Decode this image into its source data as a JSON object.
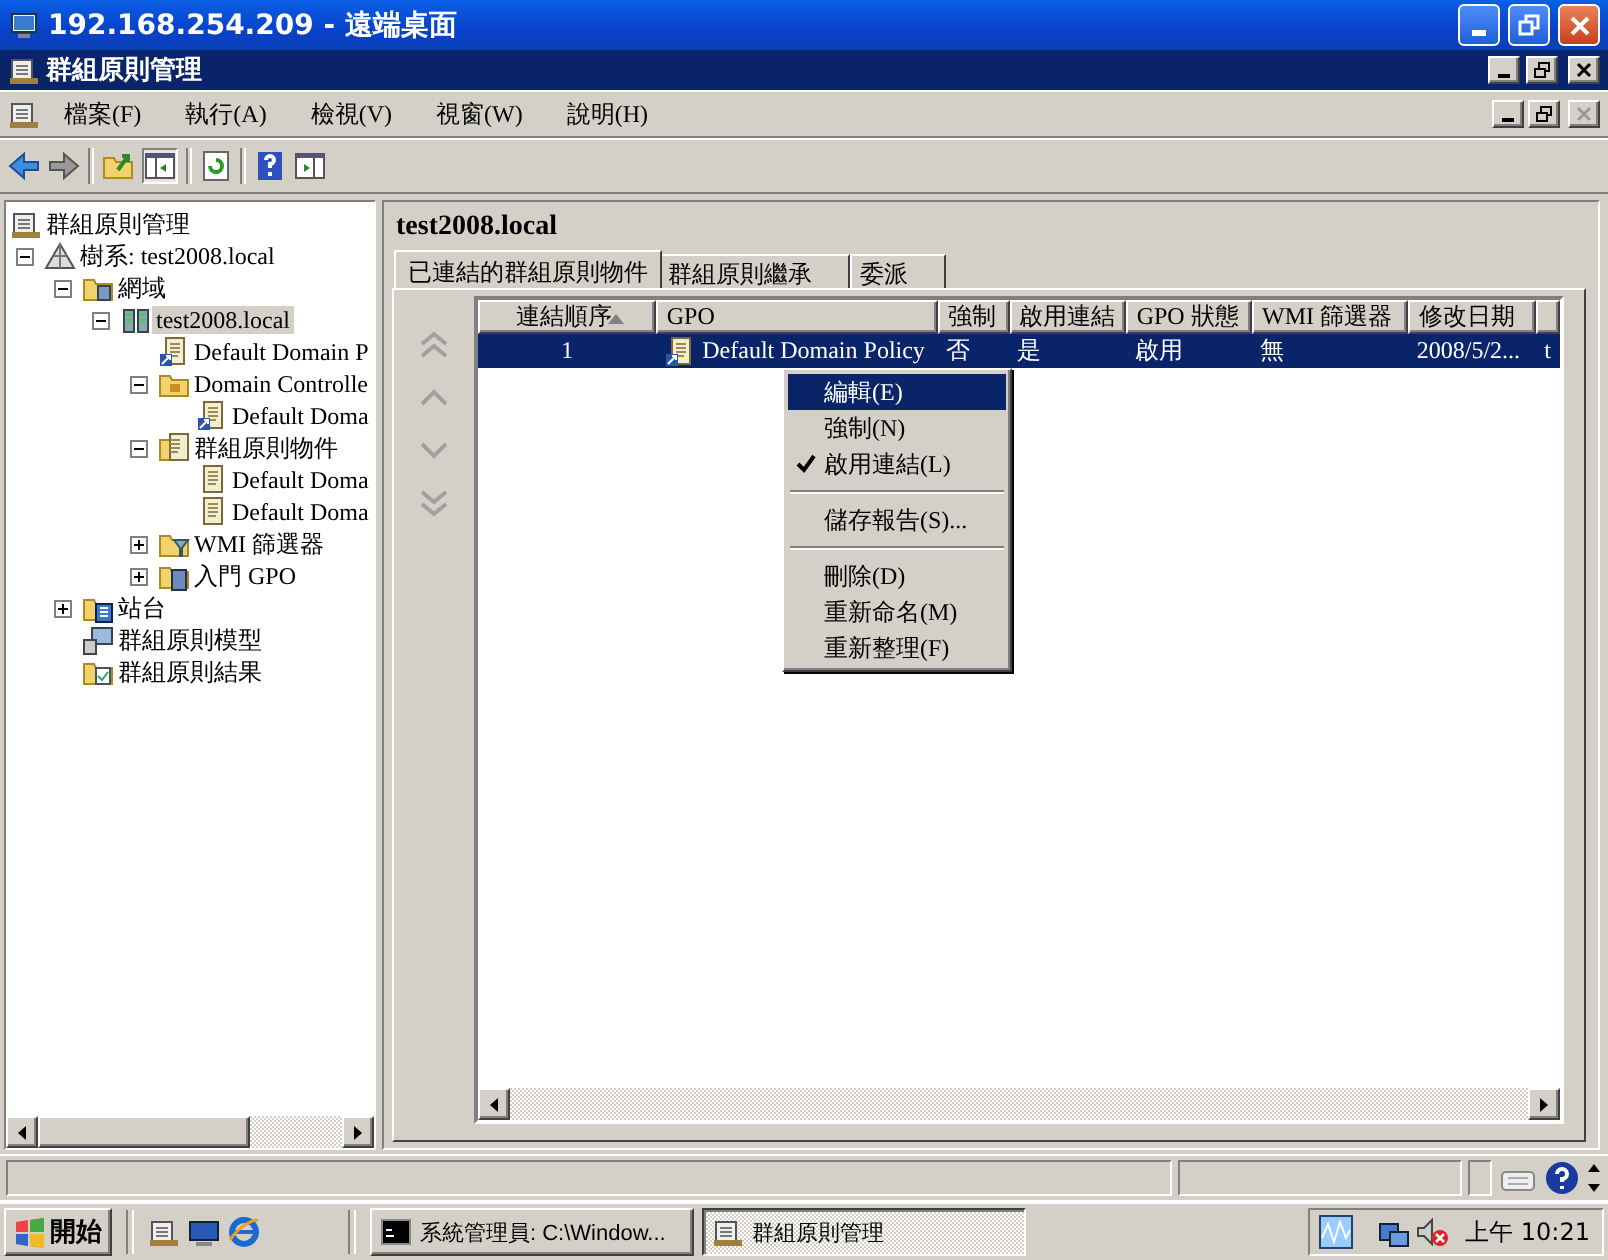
{
  "remote_window": {
    "title": "192.168.254.209 - 遠端桌面"
  },
  "app_window": {
    "title": "群組原則管理"
  },
  "menu_bar": [
    "檔案(F)",
    "執行(A)",
    "檢視(V)",
    "視窗(W)",
    "說明(H)"
  ],
  "tree": [
    {
      "label": "群組原則管理",
      "kind": "root",
      "selected": false,
      "children": [
        {
          "label": "樹系: test2008.local",
          "kind": "forest",
          "selected": false,
          "expanded": true,
          "children": [
            {
              "label": "網域",
              "kind": "domains",
              "selected": false,
              "expanded": true,
              "children": [
                {
                  "label": "test2008.local",
                  "kind": "domain",
                  "selected": true,
                  "expanded": true,
                  "children": [
                    {
                      "label": "Default Domain P",
                      "kind": "gpo-link",
                      "selected": false
                    },
                    {
                      "label": "Domain Controlle",
                      "kind": "ou",
                      "selected": false,
                      "expanded": true,
                      "children": [
                        {
                          "label": "Default Doma",
                          "kind": "gpo-link",
                          "selected": false
                        }
                      ]
                    },
                    {
                      "label": "群組原則物件",
                      "kind": "gpo-folder",
                      "selected": false,
                      "expanded": true,
                      "children": [
                        {
                          "label": "Default Doma",
                          "kind": "gpo",
                          "selected": false
                        },
                        {
                          "label": "Default Doma",
                          "kind": "gpo",
                          "selected": false
                        }
                      ]
                    },
                    {
                      "label": "WMI 篩選器",
                      "kind": "filter",
                      "selected": false,
                      "expanded": false
                    },
                    {
                      "label": "入門 GPO",
                      "kind": "starter",
                      "selected": false,
                      "expanded": false
                    }
                  ]
                }
              ]
            },
            {
              "label": "站台",
              "kind": "sites",
              "selected": false,
              "expanded": false
            },
            {
              "label": "群組原則模型",
              "kind": "modeling",
              "selected": false
            },
            {
              "label": "群組原則結果",
              "kind": "results",
              "selected": false
            }
          ]
        }
      ]
    }
  ],
  "details": {
    "heading": "test2008.local",
    "tabs": [
      {
        "label": "已連結的群組原則物件",
        "selected": true
      },
      {
        "label": "群組原則繼承",
        "selected": false
      },
      {
        "label": "委派",
        "selected": false
      }
    ],
    "columns": [
      {
        "label": "連結順序",
        "sorted": true
      },
      {
        "label": "GPO",
        "sorted": false
      },
      {
        "label": "強制",
        "sorted": false
      },
      {
        "label": "啟用連結",
        "sorted": false
      },
      {
        "label": "GPO 狀態",
        "sorted": false
      },
      {
        "label": "WMI 篩選器",
        "sorted": false
      },
      {
        "label": "修改日期",
        "sorted": false
      },
      {
        "sorted": false
      }
    ],
    "rows": [
      {
        "selected": true,
        "cells": [
          "1",
          "Default Domain Policy",
          "否",
          "是",
          "啟用",
          "無",
          "2008/5/2...",
          "t"
        ]
      }
    ]
  },
  "context_menu": [
    {
      "kind": "item",
      "label": "編輯(E)",
      "selected": true,
      "checked": false
    },
    {
      "kind": "item",
      "label": "強制(N)",
      "selected": false,
      "checked": false
    },
    {
      "kind": "item",
      "label": "啟用連結(L)",
      "selected": false,
      "checked": true
    },
    {
      "kind": "separator"
    },
    {
      "kind": "item",
      "label": "儲存報告(S)...",
      "selected": false,
      "checked": false
    },
    {
      "kind": "separator"
    },
    {
      "kind": "item",
      "label": "刪除(D)",
      "selected": false,
      "checked": false
    },
    {
      "kind": "item",
      "label": "重新命名(M)",
      "selected": false,
      "checked": false
    },
    {
      "kind": "item",
      "label": "重新整理(F)",
      "selected": false,
      "checked": false
    }
  ],
  "taskbar": {
    "start": "開始",
    "tasks": [
      {
        "label": "系統管理員: C:\\Window...",
        "selected": false
      },
      {
        "label": "群組原則管理",
        "selected": true
      }
    ],
    "clock": "上午 10:21"
  }
}
